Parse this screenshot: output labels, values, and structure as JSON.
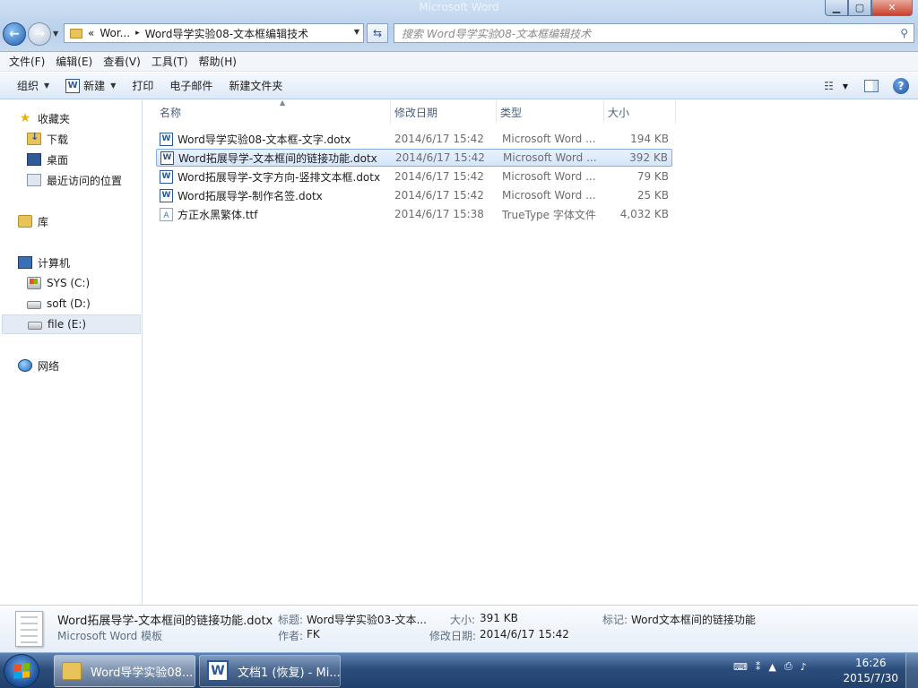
{
  "window": {
    "ghost_title": "Microsoft Word",
    "controls": {
      "minimize": "▁",
      "maximize": "▢",
      "close": "✕"
    }
  },
  "navigation": {
    "back": "←",
    "forward": "→",
    "address": {
      "overflow": "«",
      "crumbs": [
        "Wor...",
        "Word导学实验08-文本框编辑技术"
      ],
      "separator": "▸"
    },
    "refresh": "⇆",
    "search_placeholder": "搜索 Word导学实验08-文本框编辑技术"
  },
  "menu": [
    "文件(F)",
    "编辑(E)",
    "查看(V)",
    "工具(T)",
    "帮助(H)"
  ],
  "commands": {
    "organize": "组织",
    "new": "新建",
    "print": "打印",
    "email": "电子邮件",
    "new_folder": "新建文件夹",
    "views_glyph": "☷"
  },
  "nav_pane": {
    "favorites": {
      "label": "收藏夹",
      "items": [
        "下载",
        "桌面",
        "最近访问的位置"
      ]
    },
    "libraries": "库",
    "computer": {
      "label": "计算机",
      "drives": [
        "SYS (C:)",
        "soft (D:)",
        "file (E:)"
      ],
      "selected_drive": "file (E:)"
    },
    "network": "网络"
  },
  "columns": {
    "name": "名称",
    "modified": "修改日期",
    "type": "类型",
    "size": "大小"
  },
  "files": [
    {
      "name": "Word导学实验08-文本框-文字.dotx",
      "date": "2014/6/17 15:42",
      "type": "Microsoft Word ...",
      "size": "194 KB",
      "icon": "word-doc-icon"
    },
    {
      "name": "Word拓展导学-文本框间的链接功能.dotx",
      "date": "2014/6/17 15:42",
      "type": "Microsoft Word ...",
      "size": "392 KB",
      "icon": "word-doc-icon",
      "selected": true
    },
    {
      "name": "Word拓展导学-文字方向-竖排文本框.dotx",
      "date": "2014/6/17 15:42",
      "type": "Microsoft Word ...",
      "size": "79 KB",
      "icon": "word-doc-icon"
    },
    {
      "name": "Word拓展导学-制作名签.dotx",
      "date": "2014/6/17 15:42",
      "type": "Microsoft Word ...",
      "size": "25 KB",
      "icon": "word-doc-icon"
    },
    {
      "name": "方正水黑繁体.ttf",
      "date": "2014/6/17 15:38",
      "type": "TrueType 字体文件",
      "size": "4,032 KB",
      "icon": "font-file-icon"
    }
  ],
  "details": {
    "filename": "Word拓展导学-文本框间的链接功能.dotx",
    "filetype": "Microsoft Word 模板",
    "title_label": "标题:",
    "title_value": "Word导学实验03-文本...",
    "author_label": "作者:",
    "author_value": "FK",
    "size_label": "大小:",
    "size_value": "391 KB",
    "modified_label": "修改日期:",
    "modified_value": "2014/6/17 15:42",
    "tags_label": "标记:",
    "tags_value": "Word文本框间的链接功能"
  },
  "taskbar": {
    "tasks": [
      {
        "label": "Word导学实验08...",
        "active": true
      },
      {
        "label": "文档1 (恢复) - Mi...",
        "active": false
      }
    ],
    "tray": [
      "⌨",
      "⁑",
      "▲",
      "⎙",
      "♪"
    ],
    "time": "16:26",
    "date": "2015/7/30"
  }
}
